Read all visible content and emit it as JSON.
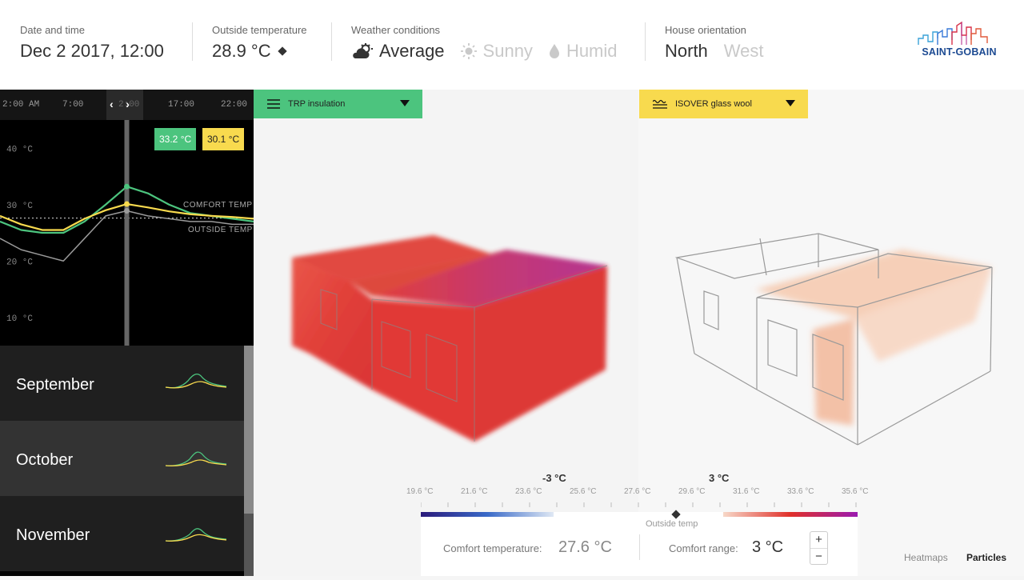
{
  "header": {
    "datetime_label": "Date and time",
    "datetime_value": "Dec 2 2017, 12:00",
    "outside_label": "Outside temperature",
    "outside_value": "28.9 °C",
    "weather_label": "Weather conditions",
    "weather_options": [
      "Average",
      "Sunny",
      "Humid"
    ],
    "orientation_label": "House orientation",
    "orientation_options": [
      "North",
      "West"
    ],
    "logo_text": "SAINT-GOBAIN"
  },
  "timeline": {
    "ticks": [
      "2:00 AM",
      "7:00",
      "2:00",
      "17:00",
      "22:00"
    ]
  },
  "chart": {
    "y_ticks": [
      "40 °C",
      "30 °C",
      "20 °C",
      "10 °C"
    ],
    "badge_green": "33.2 °C",
    "badge_yellow": "30.1 °C",
    "comfort_label": "COMFORT TEMP",
    "outside_label": "OUTSIDE TEMP"
  },
  "chart_data": {
    "type": "line",
    "ylim": [
      5,
      45
    ],
    "y_ticks": [
      40,
      30,
      20,
      10
    ],
    "current_hour_marker": 12,
    "comfort_temperature": 27.6,
    "series": [
      {
        "color": "#4cc47e",
        "x": [
          0,
          2,
          4,
          6,
          8,
          10,
          12,
          14,
          16,
          18,
          20,
          22,
          24
        ],
        "values": [
          27,
          25.5,
          25,
          25,
          27,
          30,
          33.2,
          32,
          30,
          28.5,
          28,
          27.5,
          27
        ]
      },
      {
        "color": "#f8da4e",
        "x": [
          0,
          2,
          4,
          6,
          8,
          10,
          12,
          14,
          16,
          18,
          20,
          22,
          24
        ],
        "values": [
          28,
          26.5,
          25.5,
          25.5,
          27.5,
          29,
          30.1,
          29.5,
          28.8,
          28.3,
          28,
          27.8,
          27.5
        ]
      },
      {
        "color": "#9a9a9a",
        "x": [
          0,
          2,
          4,
          6,
          8,
          10,
          12,
          14,
          16,
          18,
          20,
          22,
          24
        ],
        "values": [
          24,
          22,
          21,
          20,
          24,
          28,
          28.9,
          28,
          27.5,
          27,
          27,
          26.5,
          26.5
        ]
      }
    ]
  },
  "months": [
    {
      "name": "September"
    },
    {
      "name": "October"
    },
    {
      "name": "November"
    }
  ],
  "materials": {
    "left": "TRP insulation",
    "right": "ISOVER glass wool"
  },
  "scale": {
    "delta_left": "-3 °C",
    "delta_right": "3 °C",
    "ticks": [
      "19.6 °C",
      "21.6 °C",
      "23.6 °C",
      "25.6 °C",
      "27.6 °C",
      "29.6 °C",
      "31.6 °C",
      "33.6 °C",
      "35.6 °C"
    ],
    "outside_label": "Outside temp"
  },
  "comfort": {
    "temp_label": "Comfort temperature:",
    "temp_value": "27.6 °C",
    "range_label": "Comfort range:",
    "range_value": "3 °C",
    "plus": "+",
    "minus": "−"
  },
  "modes": [
    "Heatmaps",
    "Particles"
  ],
  "colors": {
    "green": "#4cc47e",
    "yellow": "#f8da4e",
    "heat_red": "#e0302a",
    "heat_purple": "#b0248a"
  }
}
